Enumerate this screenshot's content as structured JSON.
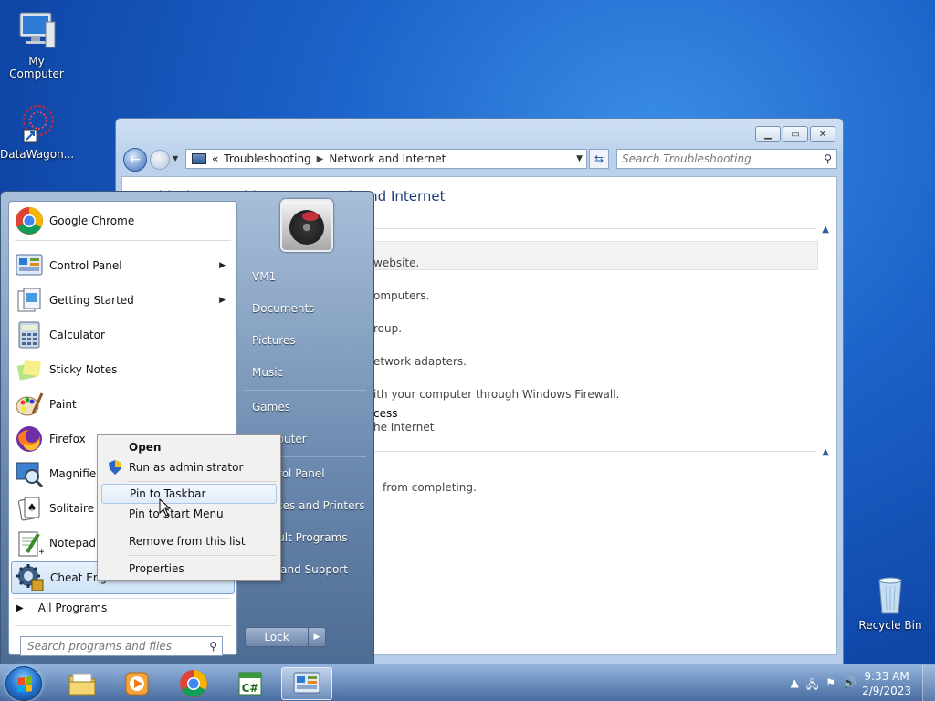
{
  "desktop": {
    "icons": [
      {
        "label": "My Computer"
      },
      {
        "label": "DataWagon..."
      },
      {
        "label": "Recycle Bin"
      }
    ]
  },
  "window": {
    "address": {
      "crumbs": [
        "Troubleshooting",
        "Network and Internet"
      ],
      "prefix": "«"
    },
    "search_placeholder": "Search Troubleshooting",
    "content_title": "Troubleshoot problems - Network and Internet",
    "visible_fragments": [
      "website.",
      "omputers.",
      "roup.",
      "etwork adapters.",
      "ith your computer through Windows Firewall.",
      "cess",
      "he Internet",
      "from completing."
    ]
  },
  "start_menu": {
    "programs": [
      {
        "label": "Google Chrome",
        "icon": "chrome-icon"
      },
      {
        "label": "Control Panel",
        "icon": "control-panel-icon",
        "submenu": true
      },
      {
        "label": "Getting Started",
        "icon": "getting-started-icon",
        "submenu": true
      },
      {
        "label": "Calculator",
        "icon": "calculator-icon"
      },
      {
        "label": "Sticky Notes",
        "icon": "sticky-notes-icon"
      },
      {
        "label": "Paint",
        "icon": "paint-icon"
      },
      {
        "label": "Firefox",
        "icon": "firefox-icon",
        "submenu": true
      },
      {
        "label": "Magnifier",
        "icon": "magnifier-icon"
      },
      {
        "label": "Solitaire",
        "icon": "solitaire-icon"
      },
      {
        "label": "Notepad++",
        "icon": "notepadpp-icon"
      },
      {
        "label": "Cheat Engine",
        "icon": "cheat-engine-icon"
      }
    ],
    "all_programs": "All Programs",
    "search_placeholder": "Search programs and files",
    "right_items": [
      "VM1",
      "Documents",
      "Pictures",
      "Music",
      "Games",
      "Computer",
      "Control Panel",
      "Devices and Printers",
      "Default Programs",
      "Help and Support"
    ],
    "lock_label": "Lock"
  },
  "context_menu": {
    "items": [
      {
        "label": "Open",
        "bold": true
      },
      {
        "label": "Run as administrator",
        "shield": true
      },
      {
        "label": "Pin to Taskbar",
        "highlighted": true
      },
      {
        "label": "Pin to Start Menu"
      },
      {
        "label": "Remove from this list"
      },
      {
        "label": "Properties"
      }
    ]
  },
  "taskbar": {
    "apps": [
      "explorer-icon",
      "media-player-icon",
      "chrome-icon",
      "csharp-icon",
      "control-panel-icon"
    ],
    "clock": {
      "time": "9:33 AM",
      "date": "2/9/2023"
    }
  }
}
